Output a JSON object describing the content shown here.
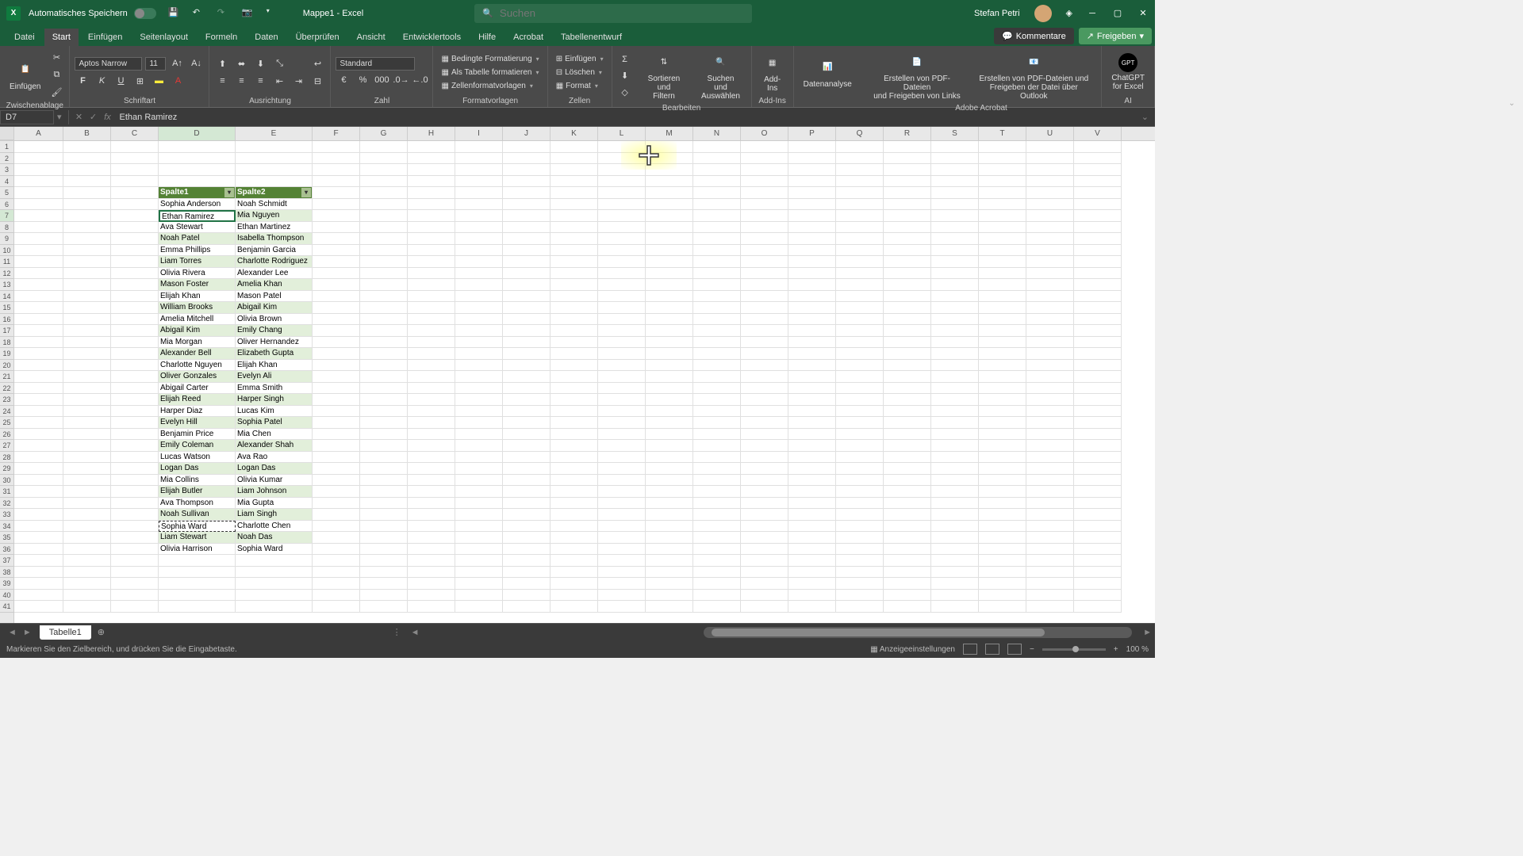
{
  "titlebar": {
    "autosave_label": "Automatisches Speichern",
    "doc_title": "Mappe1 - Excel",
    "search_placeholder": "Suchen",
    "user_name": "Stefan Petri"
  },
  "tabs": {
    "items": [
      "Datei",
      "Start",
      "Einfügen",
      "Seitenlayout",
      "Formeln",
      "Daten",
      "Überprüfen",
      "Ansicht",
      "Entwicklertools",
      "Hilfe",
      "Acrobat",
      "Tabellenentwurf"
    ],
    "active": "Start",
    "comments": "Kommentare",
    "share": "Freigeben"
  },
  "ribbon": {
    "clipboard": {
      "paste": "Einfügen",
      "label": "Zwischenablage"
    },
    "font": {
      "name": "Aptos Narrow",
      "size": "11",
      "label": "Schriftart"
    },
    "alignment": {
      "label": "Ausrichtung"
    },
    "number": {
      "format": "Standard",
      "label": "Zahl"
    },
    "styles": {
      "cond_format": "Bedingte Formatierung",
      "as_table": "Als Tabelle formatieren",
      "cell_styles": "Zellenformatvorlagen",
      "label": "Formatvorlagen"
    },
    "cells": {
      "insert": "Einfügen",
      "delete": "Löschen",
      "format": "Format",
      "label": "Zellen"
    },
    "editing": {
      "sort": "Sortieren und\nFiltern",
      "find": "Suchen und\nAuswählen",
      "label": "Bearbeiten"
    },
    "addins": {
      "addins": "Add-\nIns",
      "label": "Add-Ins"
    },
    "analysis": {
      "data_analysis": "Datenanalyse"
    },
    "adobe": {
      "pdf_links": "Erstellen von PDF-Dateien\nund Freigeben von Links",
      "pdf_outlook": "Erstellen von PDF-Dateien und\nFreigeben der Datei über Outlook",
      "label": "Adobe Acrobat"
    },
    "ai": {
      "chatgpt": "ChatGPT\nfor Excel",
      "label": "AI"
    }
  },
  "formula_bar": {
    "name_box": "D7",
    "formula": "Ethan Ramirez"
  },
  "grid": {
    "columns": [
      "A",
      "B",
      "C",
      "D",
      "E",
      "F",
      "G",
      "H",
      "I",
      "J",
      "K",
      "L",
      "M",
      "N",
      "O",
      "P",
      "Q",
      "R",
      "S",
      "T",
      "U",
      "V"
    ],
    "active_col": "D",
    "active_row": 7,
    "copied_cell": "D34",
    "table": {
      "header_row": 5,
      "headers": [
        "Spalte1",
        "Spalte2"
      ],
      "rows": [
        [
          "Sophia Anderson",
          "Noah Schmidt"
        ],
        [
          "Ethan Ramirez",
          "Mia Nguyen"
        ],
        [
          "Ava Stewart",
          "Ethan Martinez"
        ],
        [
          "Noah Patel",
          "Isabella Thompson"
        ],
        [
          "Emma Phillips",
          "Benjamin Garcia"
        ],
        [
          "Liam Torres",
          "Charlotte Rodriguez"
        ],
        [
          "Olivia Rivera",
          "Alexander Lee"
        ],
        [
          "Mason Foster",
          "Amelia Khan"
        ],
        [
          "Elijah Khan",
          "Mason Patel"
        ],
        [
          "William Brooks",
          "Abigail Kim"
        ],
        [
          "Amelia Mitchell",
          "Olivia Brown"
        ],
        [
          "Abigail Kim",
          "Emily Chang"
        ],
        [
          "Mia Morgan",
          "Oliver Hernandez"
        ],
        [
          "Alexander Bell",
          "Elizabeth Gupta"
        ],
        [
          "Charlotte Nguyen",
          "Elijah Khan"
        ],
        [
          "Oliver Gonzales",
          "Evelyn Ali"
        ],
        [
          "Abigail Carter",
          "Emma Smith"
        ],
        [
          "Elijah Reed",
          "Harper Singh"
        ],
        [
          "Harper Diaz",
          "Lucas Kim"
        ],
        [
          "Evelyn Hill",
          "Sophia Patel"
        ],
        [
          "Benjamin Price",
          "Mia Chen"
        ],
        [
          "Emily Coleman",
          "Alexander Shah"
        ],
        [
          "Lucas Watson",
          "Ava Rao"
        ],
        [
          "Logan Das",
          "Logan Das"
        ],
        [
          "Mia Collins",
          "Olivia Kumar"
        ],
        [
          "Elijah Butler",
          "Liam Johnson"
        ],
        [
          "Ava Thompson",
          "Mia Gupta"
        ],
        [
          "Noah Sullivan",
          "Liam Singh"
        ],
        [
          "Sophia Ward",
          "Charlotte Chen"
        ],
        [
          "Liam Stewart",
          "Noah Das"
        ],
        [
          "Olivia Harrison",
          "Sophia Ward"
        ]
      ]
    }
  },
  "sheets": {
    "active": "Tabelle1"
  },
  "status": {
    "message": "Markieren Sie den Zielbereich, und drücken Sie die Eingabetaste.",
    "display_settings": "Anzeigeeinstellungen",
    "zoom": "100 %"
  }
}
